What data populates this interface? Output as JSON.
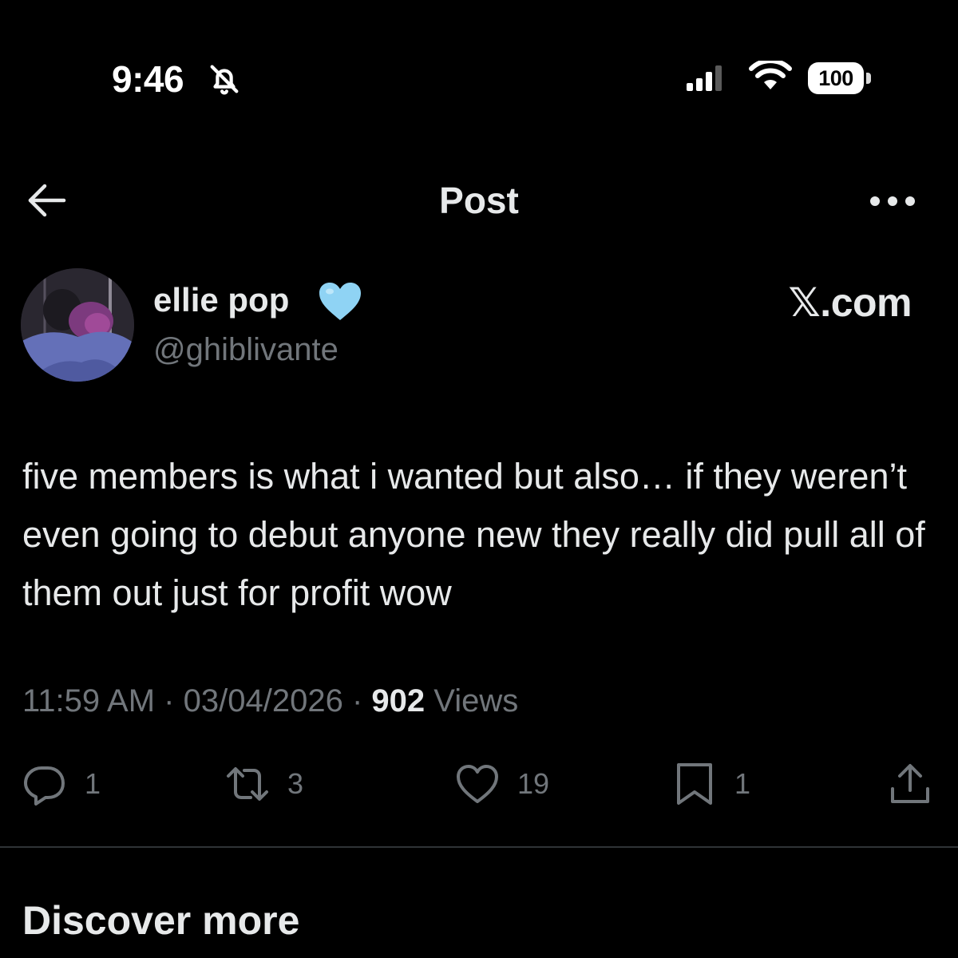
{
  "status_bar": {
    "time": "9:46",
    "battery": "100",
    "icons": [
      "bell-slash-icon",
      "signal-icon",
      "wifi-icon",
      "battery-icon"
    ]
  },
  "header": {
    "title": "Post",
    "back_icon": "arrow-left-icon",
    "more_icon": "more-horizontal-icon"
  },
  "author": {
    "display_name": "ellie pop",
    "badge": "light-blue-heart",
    "handle": "@ghiblivante",
    "source": "𝕏.com"
  },
  "post": {
    "text": "five members is what i wanted but also… if they weren’t even going to debut anyone new they really did pull all of them out just for profit wow",
    "time": "11:59 AM",
    "separator": "·",
    "date": "03/04/2026",
    "views_count": "902",
    "views_label": "Views"
  },
  "actions": {
    "reply": {
      "icon": "reply-icon",
      "count": "1"
    },
    "repost": {
      "icon": "repost-icon",
      "count": "3"
    },
    "like": {
      "icon": "heart-icon",
      "count": "19"
    },
    "bookmark": {
      "icon": "bookmark-icon",
      "count": "1"
    },
    "share": {
      "icon": "share-icon"
    }
  },
  "discover": {
    "title": "Discover more"
  },
  "colors": {
    "background": "#000000",
    "text_primary": "#e7e9ea",
    "text_secondary": "#71767b",
    "divider": "#2f3336",
    "heart_badge": "#8fd3f4"
  }
}
